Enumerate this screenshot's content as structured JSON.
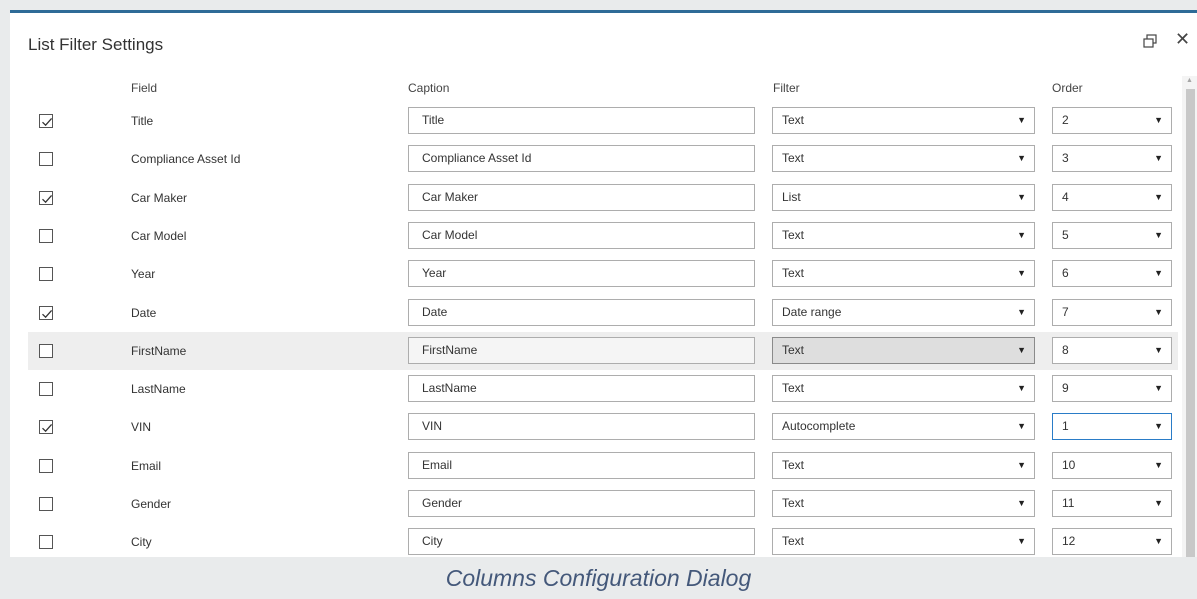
{
  "dialog": {
    "title": "List Filter Settings",
    "restore_icon": "restore-icon",
    "close_label": "✕"
  },
  "columns": {
    "field": "Field",
    "caption": "Caption",
    "filter": "Filter",
    "order": "Order"
  },
  "rows": [
    {
      "checked": true,
      "field": "Title",
      "caption": "Title",
      "filter": "Text",
      "order": "2"
    },
    {
      "checked": false,
      "field": "Compliance Asset Id",
      "caption": "Compliance Asset Id",
      "filter": "Text",
      "order": "3"
    },
    {
      "checked": true,
      "field": "Car Maker",
      "caption": "Car Maker",
      "filter": "List",
      "order": "4"
    },
    {
      "checked": false,
      "field": "Car Model",
      "caption": "Car Model",
      "filter": "Text",
      "order": "5"
    },
    {
      "checked": false,
      "field": "Year",
      "caption": "Year",
      "filter": "Text",
      "order": "6"
    },
    {
      "checked": true,
      "field": "Date",
      "caption": "Date",
      "filter": "Date range",
      "order": "7"
    },
    {
      "checked": false,
      "field": "FirstName",
      "caption": "FirstName",
      "filter": "Text",
      "order": "8"
    },
    {
      "checked": false,
      "field": "LastName",
      "caption": "LastName",
      "filter": "Text",
      "order": "9"
    },
    {
      "checked": true,
      "field": "VIN",
      "caption": "VIN",
      "filter": "Autocomplete",
      "order": "1"
    },
    {
      "checked": false,
      "field": "Email",
      "caption": "Email",
      "filter": "Text",
      "order": "10"
    },
    {
      "checked": false,
      "field": "Gender",
      "caption": "Gender",
      "filter": "Text",
      "order": "11"
    },
    {
      "checked": false,
      "field": "City",
      "caption": "City",
      "filter": "Text",
      "order": "12"
    }
  ],
  "footer_caption": "Columns Configuration Dialog",
  "colors": {
    "accent_border": "#2e6b97",
    "focus": "#2a7cc7",
    "caption_text": "#44587a"
  }
}
